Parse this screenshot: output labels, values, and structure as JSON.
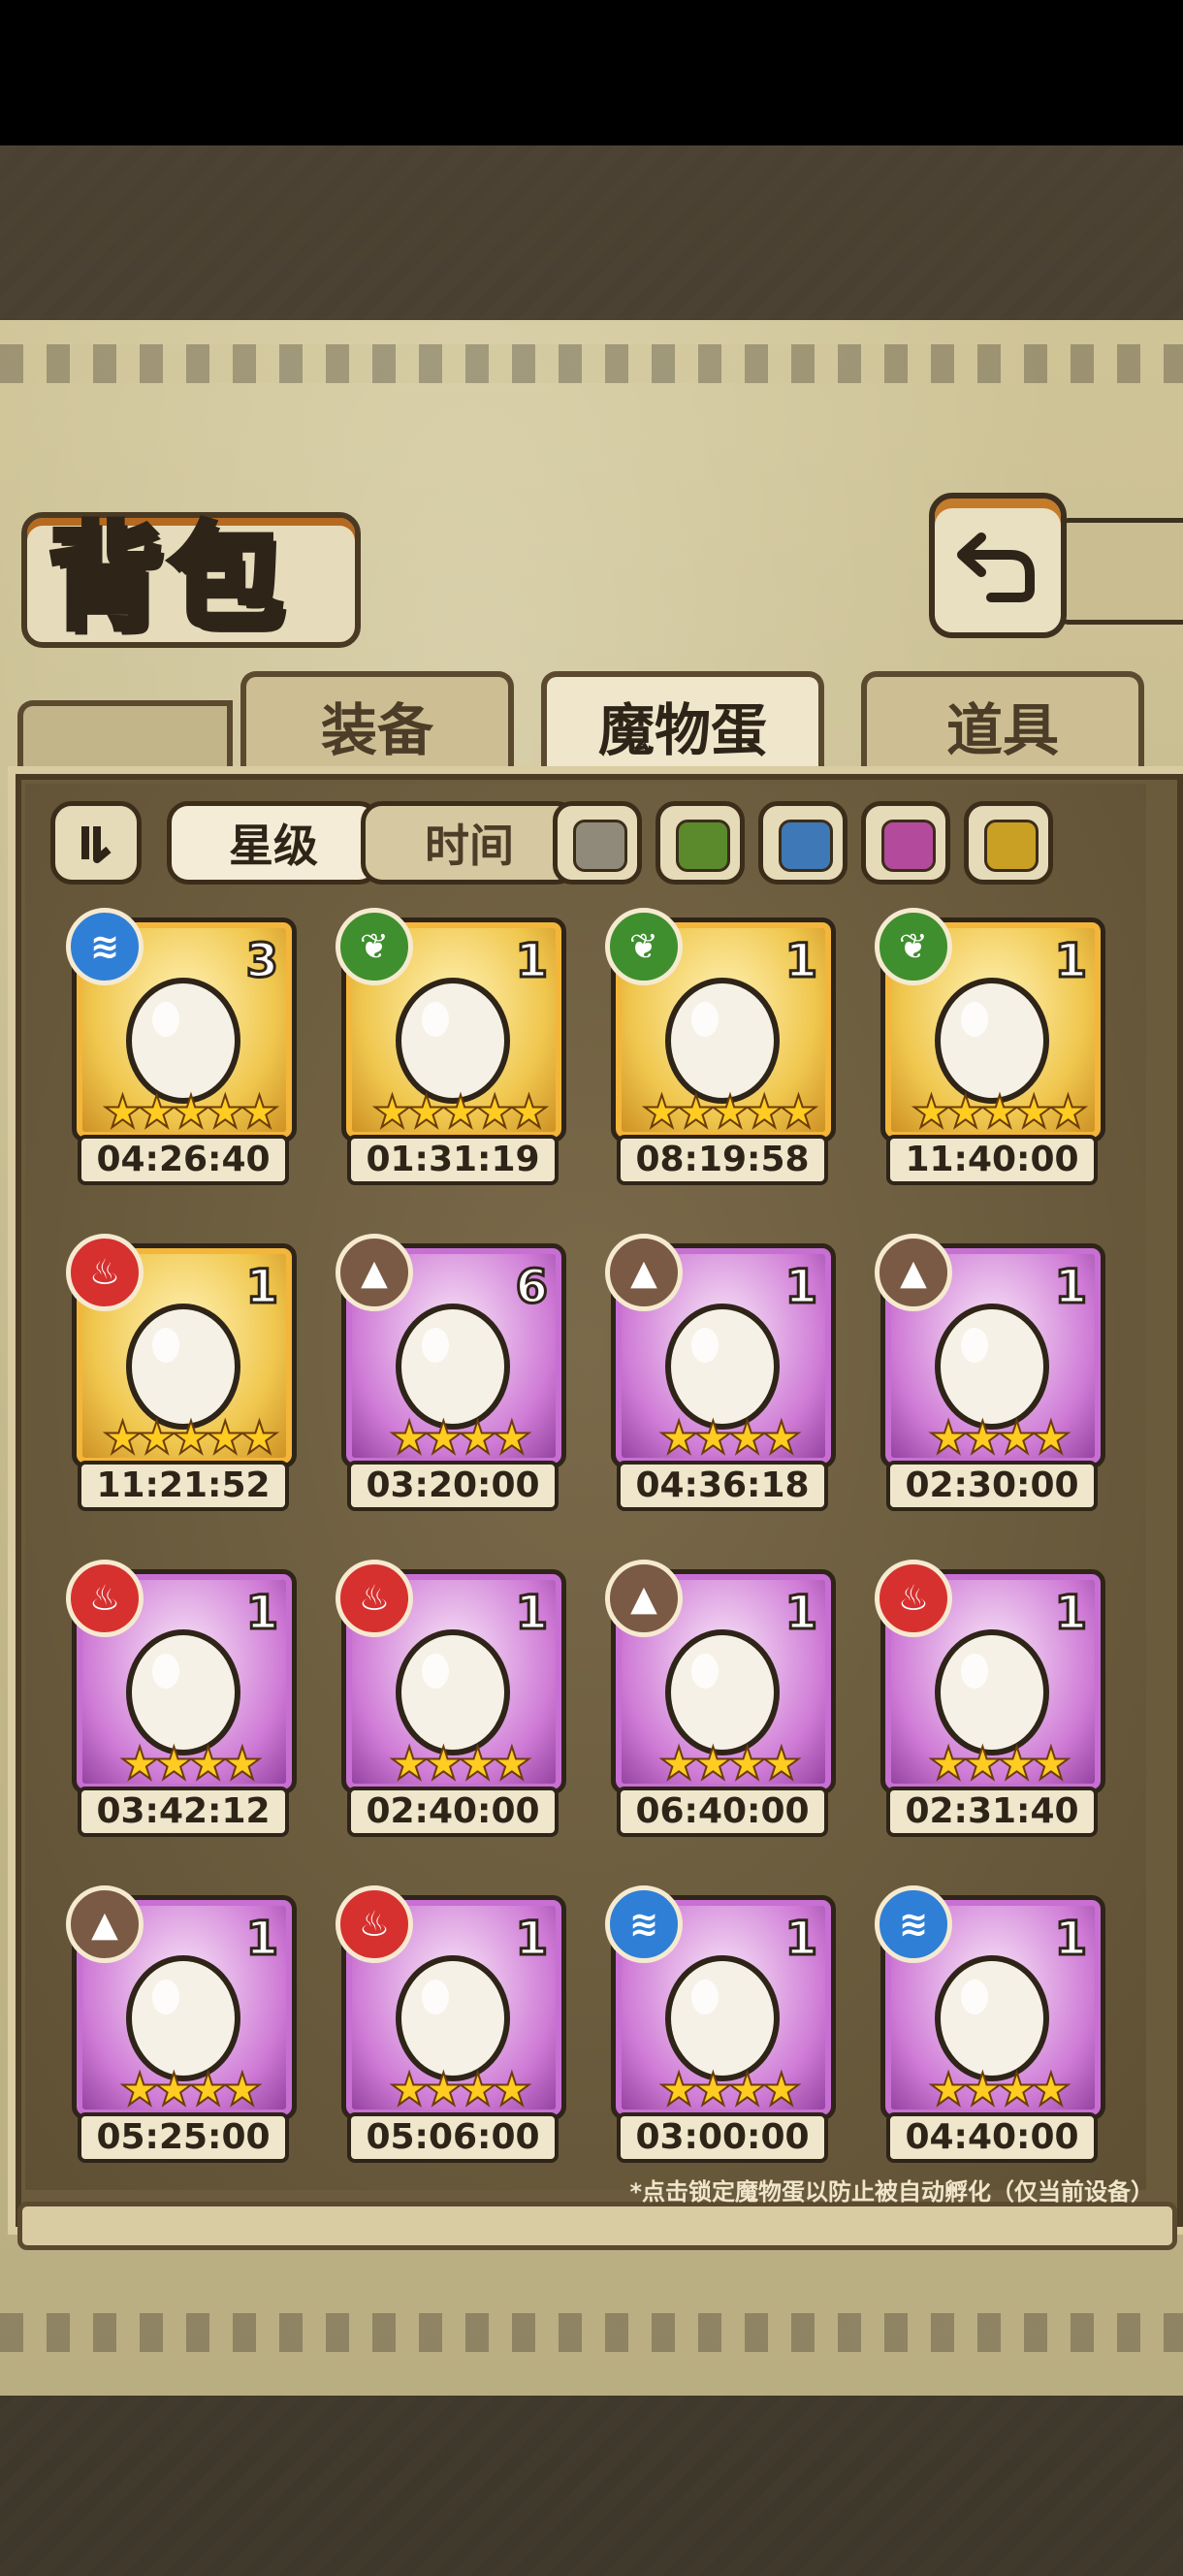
{
  "header": {
    "title": "背包"
  },
  "tabs": [
    {
      "label": "装备",
      "active": false
    },
    {
      "label": "魔物蛋",
      "active": true
    },
    {
      "label": "道具",
      "active": false
    }
  ],
  "filters": {
    "sort_icon": "pause-like-sort-icon",
    "star": {
      "label": "星级",
      "selected": true
    },
    "time": {
      "label": "时间",
      "selected": false
    },
    "colors": [
      "#8f8a7a",
      "#5a8a2c",
      "#3f78b6",
      "#b34a9c",
      "#c9a024"
    ]
  },
  "eggs": [
    {
      "time": "04:26:40",
      "count": "3",
      "stars": 5,
      "rarity": "gold",
      "element": "water",
      "icon": "dark-feather-egg-icon"
    },
    {
      "time": "01:31:19",
      "count": "1",
      "stars": 5,
      "rarity": "gold",
      "element": "grass",
      "icon": "purple-spotted-egg-icon"
    },
    {
      "time": "08:19:58",
      "count": "1",
      "stars": 5,
      "rarity": "gold",
      "element": "grass",
      "icon": "pocket-watch-egg-icon"
    },
    {
      "time": "11:40:00",
      "count": "1",
      "stars": 5,
      "rarity": "gold",
      "element": "grass",
      "icon": "angel-egg-icon"
    },
    {
      "time": "11:21:52",
      "count": "1",
      "stars": 5,
      "rarity": "gold",
      "element": "fire",
      "icon": "void-orb-egg-icon"
    },
    {
      "time": "03:20:00",
      "count": "6",
      "stars": 4,
      "rarity": "purple",
      "element": "earth",
      "icon": "sword-egg-icon"
    },
    {
      "time": "04:36:18",
      "count": "1",
      "stars": 4,
      "rarity": "purple",
      "element": "earth",
      "icon": "panda-egg-icon"
    },
    {
      "time": "02:30:00",
      "count": "1",
      "stars": 4,
      "rarity": "purple",
      "element": "earth",
      "icon": "furry-egg-icon"
    },
    {
      "time": "03:42:12",
      "count": "1",
      "stars": 4,
      "rarity": "purple",
      "element": "fire",
      "icon": "horned-egg-icon"
    },
    {
      "time": "02:40:00",
      "count": "1",
      "stars": 4,
      "rarity": "purple",
      "element": "fire",
      "icon": "lava-egg-icon"
    },
    {
      "time": "06:40:00",
      "count": "1",
      "stars": 4,
      "rarity": "purple",
      "element": "earth",
      "icon": "nest-egg-icon"
    },
    {
      "time": "02:31:40",
      "count": "1",
      "stars": 4,
      "rarity": "purple",
      "element": "fire",
      "icon": "crown-jelly-egg-icon"
    },
    {
      "time": "05:25:00",
      "count": "1",
      "stars": 4,
      "rarity": "purple",
      "element": "earth",
      "icon": "gem-fur-egg-icon"
    },
    {
      "time": "05:06:00",
      "count": "1",
      "stars": 4,
      "rarity": "purple",
      "element": "fire",
      "icon": "hooded-egg-icon"
    },
    {
      "time": "03:00:00",
      "count": "1",
      "stars": 4,
      "rarity": "purple",
      "element": "water",
      "icon": "penguin-egg-icon"
    },
    {
      "time": "04:40:00",
      "count": "1",
      "stars": 4,
      "rarity": "purple",
      "element": "water",
      "icon": "anubis-egg-icon"
    }
  ],
  "element_colors": {
    "water": "#2f7fd6",
    "grass": "#3f8f2e",
    "fire": "#d6312f",
    "earth": "#7a5a44"
  },
  "footer_hint": "*点击锁定魔物蛋以防止被自动孵化（仅当前设备）"
}
